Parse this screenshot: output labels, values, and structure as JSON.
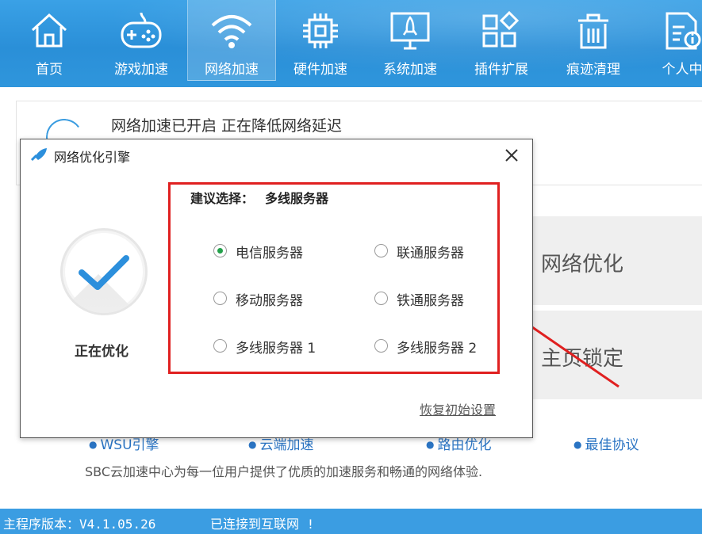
{
  "nav": {
    "items": [
      {
        "label": "首页",
        "icon": "home-icon"
      },
      {
        "label": "游戏加速",
        "icon": "gamepad-icon"
      },
      {
        "label": "网络加速",
        "icon": "wifi-icon",
        "active": true
      },
      {
        "label": "硬件加速",
        "icon": "chip-icon"
      },
      {
        "label": "系统加速",
        "icon": "monitor-rocket-icon"
      },
      {
        "label": "插件扩展",
        "icon": "plugin-grid-icon"
      },
      {
        "label": "痕迹清理",
        "icon": "trash-icon"
      },
      {
        "label": "个人中",
        "icon": "profile-doc-icon"
      }
    ]
  },
  "status": {
    "message": "网络加速已开启 正在降低网络延迟"
  },
  "background_buttons": {
    "optimize": "网络优化",
    "homepage_lock": "主页锁定"
  },
  "features": [
    "WSU引擎",
    "云端加速",
    "路由优化",
    "最佳协议"
  ],
  "tagline": "SBC云加速中心为每一位用户提供了优质的加速服务和畅通的网络体验.",
  "statusbar": {
    "version": "主程序版本：V4.1.05.26",
    "connection": "已连接到互联网 !"
  },
  "dialog": {
    "title": "网络优化引擎",
    "progress_label": "正在优化",
    "suggest_label": "建议选择：",
    "suggest_value": "多线服务器",
    "servers": [
      {
        "label": "电信服务器",
        "selected": true
      },
      {
        "label": "联通服务器",
        "selected": false
      },
      {
        "label": "移动服务器",
        "selected": false
      },
      {
        "label": "铁通服务器",
        "selected": false
      },
      {
        "label": "多线服务器 1",
        "selected": false
      },
      {
        "label": "多线服务器 2",
        "selected": false
      }
    ],
    "reset_link": "恢复初始设置"
  },
  "colors": {
    "nav_bg": "#2f96dc",
    "statusbar_bg": "#3b9de2",
    "accent_red": "#e02020",
    "radio_selected": "#23a04a",
    "check_blue": "#2c8fdc"
  }
}
